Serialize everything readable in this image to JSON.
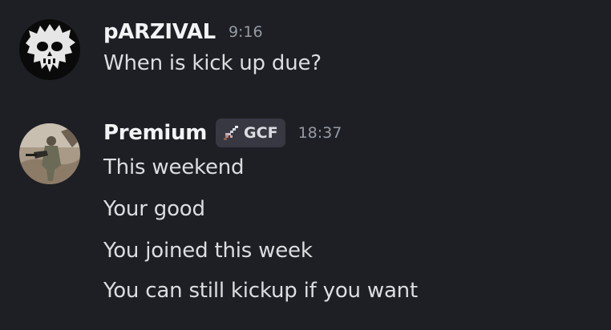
{
  "messages": [
    {
      "author": "pARZIVAL",
      "time": "9:16",
      "avatar_icon": "skull-avatar-icon",
      "lines": [
        "When is kick up due?"
      ]
    },
    {
      "author": "Premium",
      "time": "18:37",
      "avatar_icon": "soldier-photo-avatar",
      "tag": {
        "icon": "sword-icon",
        "label": "GCF"
      },
      "lines": [
        "This weekend",
        "Your good",
        "You joined this week",
        "You can still kickup if you want"
      ]
    }
  ],
  "colors": {
    "background": "#1e1f24",
    "username": "#f2f3f5",
    "message_text": "#dbdee1",
    "timestamp": "#949ba4",
    "tag_background": "#373842"
  }
}
